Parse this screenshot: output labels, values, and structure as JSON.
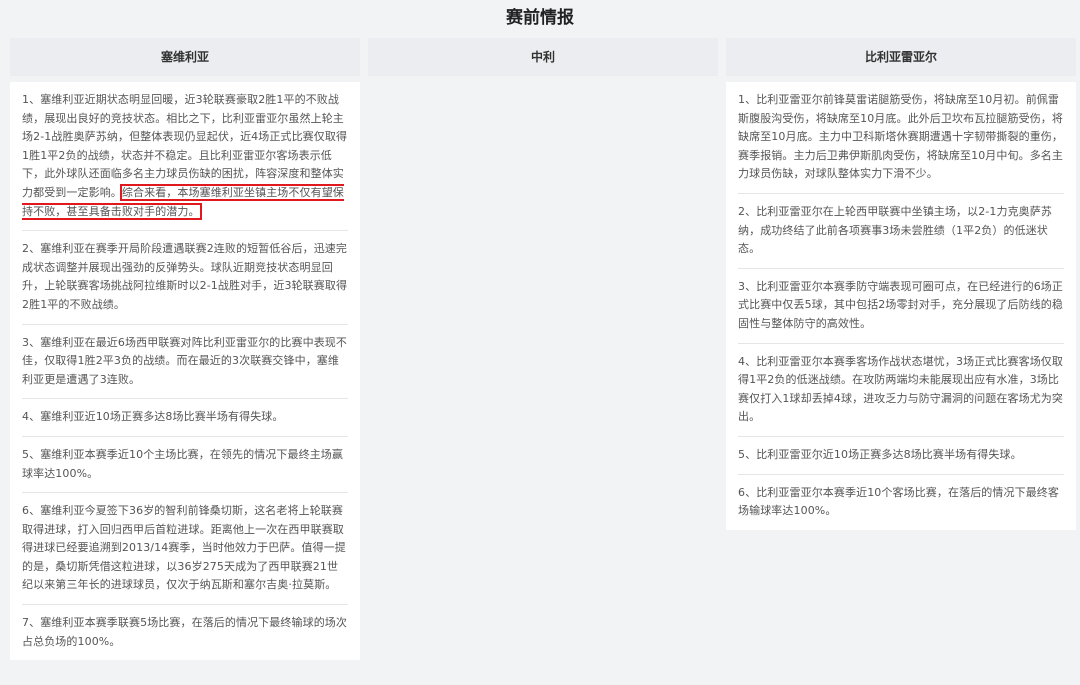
{
  "page": {
    "title": "赛前情报"
  },
  "columns": [
    {
      "header": "塞维利亚",
      "items": [
        {
          "pre": "1、塞维利亚近期状态明显回暖，近3轮联赛豪取2胜1平的不败战绩，展现出良好的竞技状态。相比之下，比利亚雷亚尔虽然上轮主场2-1战胜奥萨苏纳，但整体表现仍显起伏，近4场正式比赛仅取得1胜1平2负的战绩，状态并不稳定。且比利亚雷亚尔客场表示低下，此外球队还面临多名主力球员伤缺的困扰，阵容深度和整体实力都受到一定影响。",
          "highlight": "综合来看，本场塞维利亚坐镇主场不仅有望保持不败，甚至具备击败对手的潜力。"
        },
        {
          "text": "2、塞维利亚在赛季开局阶段遭遇联赛2连败的短暂低谷后，迅速完成状态调整并展现出强劲的反弹势头。球队近期竞技状态明显回升，上轮联赛客场挑战阿拉维斯时以2-1战胜对手，近3轮联赛取得2胜1平的不败战绩。"
        },
        {
          "text": "3、塞维利亚在最近6场西甲联赛对阵比利亚雷亚尔的比赛中表现不佳，仅取得1胜2平3负的战绩。而在最近的3次联赛交锋中，塞维利亚更是遭遇了3连败。"
        },
        {
          "text": "4、塞维利亚近10场正赛多达8场比赛半场有得失球。"
        },
        {
          "text": "5、塞维利亚本赛季近10个主场比赛，在领先的情况下最终主场赢球率达100%。"
        },
        {
          "text": "6、塞维利亚今夏签下36岁的智利前锋桑切斯，这名老将上轮联赛取得进球，打入回归西甲后首粒进球。距离他上一次在西甲联赛取得进球已经要追溯到2013/14赛季，当时他效力于巴萨。值得一提的是，桑切斯凭借这粒进球，以36岁275天成为了西甲联赛21世纪以来第三年长的进球球员，仅次于纳瓦斯和塞尔吉奥·拉莫斯。"
        },
        {
          "text": "7、塞维利亚本赛季联赛5场比赛，在落后的情况下最终输球的场次占总负场的100%。"
        }
      ]
    },
    {
      "header": "中利",
      "items": []
    },
    {
      "header": "比利亚雷亚尔",
      "items": [
        {
          "text": "1、比利亚雷亚尔前锋莫雷诺腿筋受伤，将缺席至10月初。前佩雷斯腹股沟受伤，将缺席至10月底。此外后卫坎布瓦拉腿筋受伤，将缺席至10月底。主力中卫科斯塔休赛期遭遇十字韧带撕裂的重伤，赛季报销。主力后卫弗伊斯肌肉受伤，将缺席至10月中旬。多名主力球员伤缺，对球队整体实力下滑不少。"
        },
        {
          "text": "2、比利亚雷亚尔在上轮西甲联赛中坐镇主场，以2-1力克奥萨苏纳，成功终结了此前各项赛事3场未尝胜绩（1平2负）的低迷状态。"
        },
        {
          "text": "3、比利亚雷亚尔本赛季防守端表现可圈可点，在已经进行的6场正式比赛中仅丢5球，其中包括2场零封对手，充分展现了后防线的稳固性与整体防守的高效性。"
        },
        {
          "text": "4、比利亚雷亚尔本赛季客场作战状态堪忧，3场正式比赛客场仅取得1平2负的低迷战绩。在攻防两端均未能展现出应有水准，3场比赛仅打入1球却丢掉4球，进攻乏力与防守漏洞的问题在客场尤为突出。"
        },
        {
          "text": "5、比利亚雷亚尔近10场正赛多达8场比赛半场有得失球。"
        },
        {
          "text": "6、比利亚雷亚尔本赛季近10个客场比赛，在落后的情况下最终客场输球率达100%。"
        }
      ]
    }
  ]
}
